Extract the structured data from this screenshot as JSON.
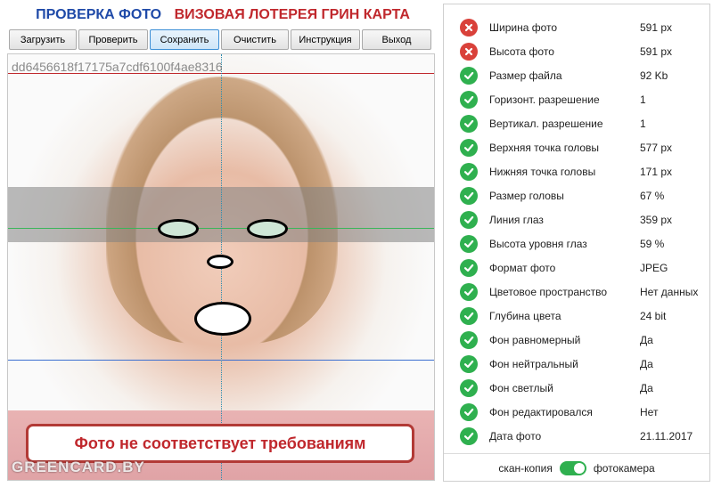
{
  "header": {
    "title_blue": "ПРОВЕРКА ФОТО",
    "title_red": "ВИЗОВАЯ ЛОТЕРЕЯ ГРИН КАРТА"
  },
  "toolbar": {
    "load": "Загрузить",
    "check": "Проверить",
    "save": "Сохранить",
    "clear": "Очистить",
    "instruction": "Инструкция",
    "exit": "Выход"
  },
  "photo": {
    "hash": "dd6456618f17175a7cdf6100f4ae8316",
    "warning": "Фото не соответствует требованиям",
    "watermark": "GREENCARD.BY"
  },
  "checks": [
    {
      "label": "Ширина фото",
      "value": "591 px",
      "status": "fail"
    },
    {
      "label": "Высота фото",
      "value": "591 px",
      "status": "fail"
    },
    {
      "label": "Размер файла",
      "value": "92 Kb",
      "status": "ok"
    },
    {
      "label": "Горизонт. разрешение",
      "value": "1",
      "status": "ok"
    },
    {
      "label": "Вертикал. разрешение",
      "value": "1",
      "status": "ok"
    },
    {
      "label": "Верхняя точка головы",
      "value": "577 px",
      "status": "ok"
    },
    {
      "label": "Нижняя точка головы",
      "value": "171 px",
      "status": "ok"
    },
    {
      "label": "Размер головы",
      "value": "67 %",
      "status": "ok"
    },
    {
      "label": "Линия глаз",
      "value": "359 px",
      "status": "ok"
    },
    {
      "label": "Высота уровня глаз",
      "value": "59 %",
      "status": "ok"
    },
    {
      "label": "Формат фото",
      "value": "JPEG",
      "status": "ok"
    },
    {
      "label": "Цветовое пространство",
      "value": "Нет данных",
      "status": "ok"
    },
    {
      "label": "Глубина цвета",
      "value": "24 bit",
      "status": "ok"
    },
    {
      "label": "Фон равномерный",
      "value": "Да",
      "status": "ok"
    },
    {
      "label": "Фон нейтральный",
      "value": "Да",
      "status": "ok"
    },
    {
      "label": "Фон светлый",
      "value": "Да",
      "status": "ok"
    },
    {
      "label": "Фон редактировался",
      "value": "Нет",
      "status": "ok"
    },
    {
      "label": "Дата фото",
      "value": "21.11.2017",
      "status": "ok"
    }
  ],
  "mode": {
    "left": "скан-копия",
    "right": "фотокамера",
    "selected": "фотокамера"
  },
  "colors": {
    "ok": "#2fb04f",
    "fail": "#d9413a",
    "accent_blue": "#1f4aa8",
    "accent_red": "#c0282d"
  }
}
